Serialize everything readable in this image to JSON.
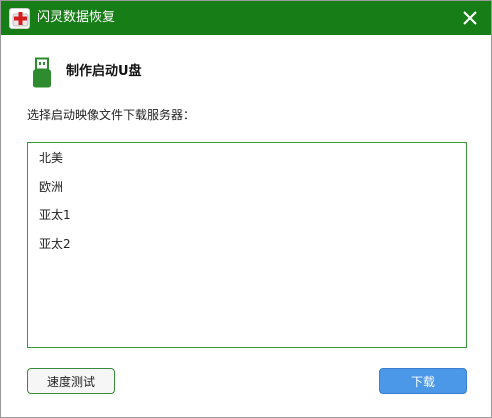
{
  "window": {
    "title": "闪灵数据恢复",
    "titlebar_color": "#177e17"
  },
  "header": {
    "title": "制作启动U盘",
    "icon": "usb-drive-icon"
  },
  "prompt": "选择启动映像文件下载服务器：",
  "servers": [
    {
      "label": "北美"
    },
    {
      "label": "欧洲"
    },
    {
      "label": "亚太1"
    },
    {
      "label": "亚太2"
    }
  ],
  "buttons": {
    "speed_test": "速度测试",
    "download": "下载"
  },
  "colors": {
    "accent_green": "#177e17",
    "list_border": "#3a9a3a",
    "primary_button": "#4b97e8"
  }
}
